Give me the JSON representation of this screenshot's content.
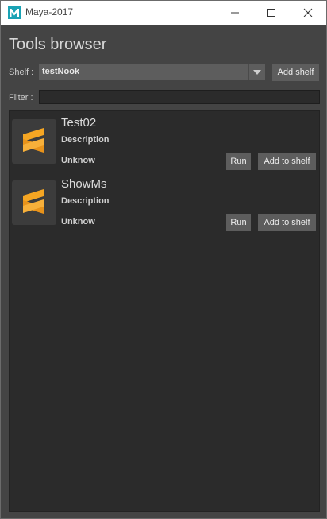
{
  "window": {
    "title": "Maya-2017"
  },
  "page": {
    "heading": "Tools browser"
  },
  "shelf": {
    "label": "Shelf :",
    "selected": "testNook",
    "add_shelf_label": "Add shelf"
  },
  "filter": {
    "label": "Filter :",
    "value": ""
  },
  "tools": [
    {
      "name": "Test02",
      "description": "Description",
      "author": "Unknow",
      "run_label": "Run",
      "add_label": "Add to shelf"
    },
    {
      "name": "ShowMs",
      "description": "Description",
      "author": "Unknow",
      "run_label": "Run",
      "add_label": "Add to shelf"
    }
  ],
  "colors": {
    "accent_icon": "#f5a623",
    "background": "#444444",
    "panel": "#2b2b2b"
  },
  "icons": {
    "app": "maya-icon",
    "tool": "sublime-text-icon",
    "minimize": "minimize-icon",
    "maximize": "maximize-icon",
    "close": "close-icon",
    "dropdown": "chevron-down-icon"
  }
}
